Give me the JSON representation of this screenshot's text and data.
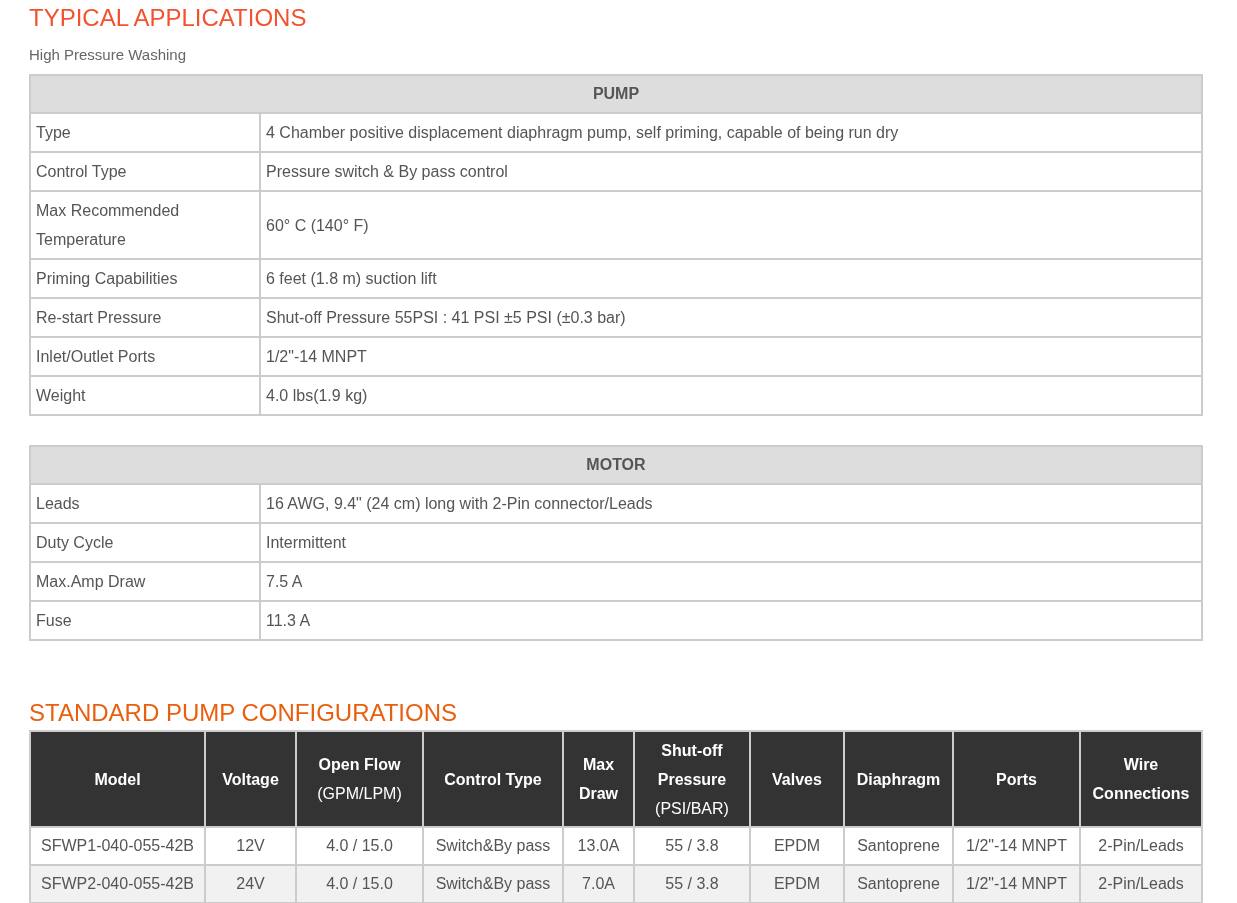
{
  "applications": {
    "heading": "TYPICAL APPLICATIONS",
    "text": "High Pressure Washing"
  },
  "spec_tables": [
    {
      "header": "PUMP",
      "rows": [
        {
          "label": "Type",
          "value": "4 Chamber positive displacement diaphragm pump, self priming, capable of being run dry"
        },
        {
          "label": "Control Type",
          "value": "Pressure switch & By pass control"
        },
        {
          "label": "Max Recommended Temperature",
          "value": "60° C  (140° F)"
        },
        {
          "label": "Priming Capabilities",
          "value": "6 feet (1.8 m) suction lift"
        },
        {
          "label": "Re-start Pressure",
          "value": "Shut-off Pressure 55PSI : 41 PSI ±5 PSI (±0.3 bar)"
        },
        {
          "label": "Inlet/Outlet Ports",
          "value": "1/2\"-14 MNPT"
        },
        {
          "label": "Weight",
          "value": "4.0 lbs(1.9 kg)"
        }
      ]
    },
    {
      "header": "MOTOR",
      "rows": [
        {
          "label": "Leads",
          "value": "16 AWG, 9.4\" (24 cm) long with 2-Pin connector/Leads"
        },
        {
          "label": "Duty Cycle",
          "value": "Intermittent"
        },
        {
          "label": "Max.Amp Draw",
          "value": "7.5 A"
        },
        {
          "label": "Fuse",
          "value": "11.3 A"
        }
      ]
    }
  ],
  "configurations": {
    "heading": "STANDARD PUMP CONFIGURATIONS",
    "columns": [
      {
        "title": "Model"
      },
      {
        "title": "Voltage"
      },
      {
        "title": "Open Flow",
        "unit": "(GPM/LPM)"
      },
      {
        "title": "Control Type"
      },
      {
        "title": "Max Draw"
      },
      {
        "title": "Shut-off Pressure",
        "unit": "(PSI/BAR)"
      },
      {
        "title": "Valves"
      },
      {
        "title": "Diaphragm"
      },
      {
        "title": "Ports"
      },
      {
        "title": "Wire Connections"
      }
    ],
    "rows": [
      [
        "SFWP1-040-055-42B",
        "12V",
        "4.0 / 15.0",
        "Switch&By pass",
        "13.0A",
        "55 / 3.8",
        "EPDM",
        "Santoprene",
        "1/2\"-14 MNPT",
        "2-Pin/Leads"
      ],
      [
        "SFWP2-040-055-42B",
        "24V",
        "4.0 / 15.0",
        "Switch&By pass",
        "7.0A",
        "55 / 3.8",
        "EPDM",
        "Santoprene",
        "1/2\"-14 MNPT",
        "2-Pin/Leads"
      ]
    ]
  }
}
